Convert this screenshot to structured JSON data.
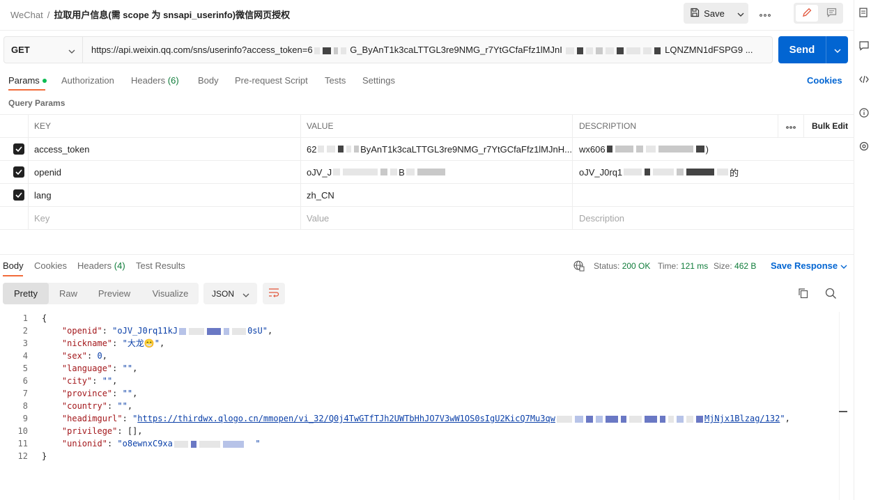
{
  "header": {
    "workspace": "WeChat",
    "separator": "/",
    "request_name": "拉取用户信息(需 scope 为 snsapi_userinfo)微信网页授权",
    "save_label": "Save"
  },
  "request": {
    "method": "GET",
    "url": "https://api.weixin.qq.com/sns/userinfo?access_token=6",
    "url_mid": "G_ByAnT1k3caLTTGL3re9NMG_r7YtGCfaFfz1lMJnI",
    "url_end": "LQNZMN1dFSPG9 ...",
    "send_label": "Send"
  },
  "tabs": {
    "params": "Params",
    "authorization": "Authorization",
    "headers": "Headers",
    "headers_count": "(6)",
    "body": "Body",
    "prerequest": "Pre-request Script",
    "tests": "Tests",
    "settings": "Settings",
    "cookies": "Cookies"
  },
  "query_params": {
    "title": "Query Params",
    "columns": {
      "key": "KEY",
      "value": "VALUE",
      "description": "DESCRIPTION",
      "bulk_edit": "Bulk Edit"
    },
    "rows": [
      {
        "key": "access_token",
        "value_a": "62",
        "value_b": "ByAnT1k3caLTTGL3re9NMG_r7YtGCfaFfz1lMJnH...",
        "desc_a": "wx606",
        "desc_b": ")"
      },
      {
        "key": "openid",
        "value_a": "oJV_J",
        "value_b": "B",
        "desc_a": "oJV_J0rq1",
        "desc_b": "的"
      },
      {
        "key": "lang",
        "value_a": "zh_CN",
        "value_b": "",
        "desc_a": "",
        "desc_b": ""
      }
    ],
    "placeholder": {
      "key": "Key",
      "value": "Value",
      "description": "Description"
    }
  },
  "response": {
    "tabs": {
      "body": "Body",
      "cookies": "Cookies",
      "headers": "Headers",
      "headers_count": "(4)",
      "test_results": "Test Results"
    },
    "status_label": "Status:",
    "status_value": "200 OK",
    "time_label": "Time:",
    "time_value": "121 ms",
    "size_label": "Size:",
    "size_value": "462 B",
    "save_response": "Save Response",
    "views": {
      "pretty": "Pretty",
      "raw": "Raw",
      "preview": "Preview",
      "visualize": "Visualize"
    },
    "format": "JSON",
    "lines": {
      "openid_prefix": "\"oJV_J0rq11kJ",
      "openid_suffix": "0sU\"",
      "nickname": "\"大龙😁\"",
      "sex": "0",
      "headimgurl_prefix": "https://thirdwx.qlogo.cn/mmopen/vi_32/Q0j4TwGTfTJh2UWTbHhJO7V3wW1OS0sIgU2KicQ7Mu3qw",
      "headimgurl_suffix": "MjNjx1Blzag/132",
      "unionid_prefix": "\"o8ewnxC9xa"
    }
  }
}
